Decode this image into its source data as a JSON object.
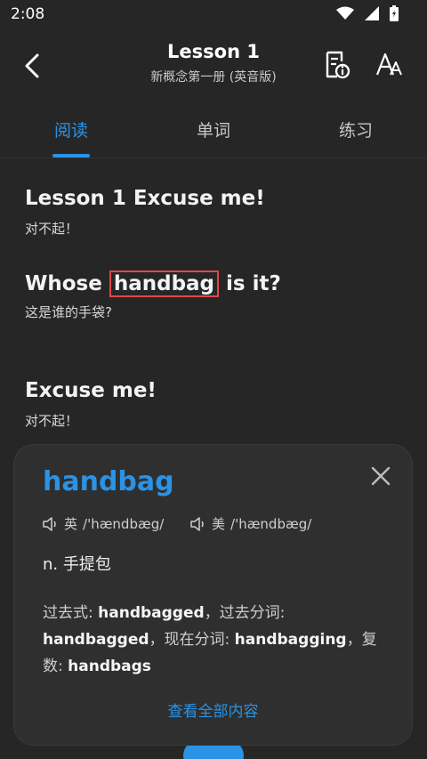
{
  "status": {
    "time": "2:08"
  },
  "header": {
    "title": "Lesson 1",
    "subtitle": "新概念第一册 (英音版)",
    "back_icon": "chevron-left-icon",
    "doc_icon": "document-info-icon",
    "font_icon": "font-size-icon"
  },
  "tabs": [
    {
      "label": "阅读",
      "active": true
    },
    {
      "label": "单词",
      "active": false
    },
    {
      "label": "练习",
      "active": false
    }
  ],
  "content": {
    "lines": [
      {
        "en": "Lesson 1 Excuse me!",
        "zh": "对不起！"
      },
      {
        "en_before": "Whose ",
        "en_highlight": "handbag",
        "en_after": " is it?",
        "zh": "这是谁的手袋?"
      },
      {
        "en": "Excuse me!",
        "zh": "对不起！"
      }
    ]
  },
  "card": {
    "word": "handbag",
    "uk_label": "英",
    "uk_phonetic": "/'hændbæg/",
    "us_label": "美",
    "us_phonetic": "/'hændbæg/",
    "definition": "n. 手提包",
    "forms": {
      "past_label": "过去式:",
      "past": "handbagged",
      "pp_label": "，过去分词:",
      "pp": "handbagged",
      "ing_label": "，现在分词:",
      "ing": "handbagging",
      "plural_label": "，复数:",
      "plural": "handbags"
    },
    "more_label": "查看全部内容"
  },
  "colors": {
    "accent": "#2a93e6",
    "highlight_border": "#e04848",
    "background": "#262626",
    "card": "#2f2f2f"
  }
}
